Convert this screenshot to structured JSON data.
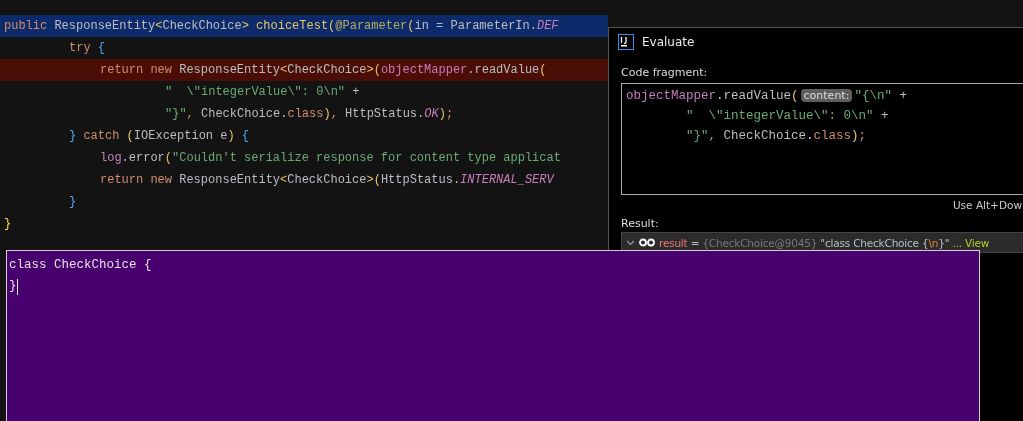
{
  "editor": {
    "lines": [
      {
        "selected": true,
        "breakpoint": false,
        "tokens": [
          {
            "kind": "keyword",
            "text": "public"
          },
          {
            "kind": "plain",
            "text": " ResponseEntity"
          },
          {
            "kind": "angle",
            "text": "<"
          },
          {
            "kind": "plain",
            "text": "CheckChoice"
          },
          {
            "kind": "angle",
            "text": ">"
          },
          {
            "kind": "method",
            "text": " choiceTest"
          },
          {
            "kind": "paren",
            "text": "("
          },
          {
            "kind": "annotation",
            "text": "@Parameter"
          },
          {
            "kind": "paren",
            "text": "("
          },
          {
            "kind": "plain",
            "text": "in = ParameterIn."
          },
          {
            "kind": "static",
            "text": "DEF"
          }
        ],
        "children": [
          {
            "tokens": [
              {
                "kind": "keyword",
                "text": "try"
              },
              {
                "kind": "brace",
                "text": " {"
              }
            ],
            "children": [
              {
                "selected": false,
                "breakpoint": true,
                "tokens": [
                  {
                    "kind": "keyword",
                    "text": "return new"
                  },
                  {
                    "kind": "plain",
                    "text": " ResponseEntity"
                  },
                  {
                    "kind": "angle",
                    "text": "<"
                  },
                  {
                    "kind": "plain",
                    "text": "CheckChoice"
                  },
                  {
                    "kind": "angle",
                    "text": ">"
                  },
                  {
                    "kind": "paren",
                    "text": "("
                  },
                  {
                    "kind": "field",
                    "text": "objectMapper"
                  },
                  {
                    "kind": "plain",
                    "text": ".readValue"
                  },
                  {
                    "kind": "paren",
                    "text": "("
                  }
                ],
                "children": [
                  {
                    "tokens": [
                      {
                        "kind": "string",
                        "text": "\"  \\\"integerValue\\\": 0\\n\""
                      },
                      {
                        "kind": "plain",
                        "text": " +"
                      }
                    ]
                  },
                  {
                    "tokens": [
                      {
                        "kind": "string",
                        "text": "\"}\""
                      },
                      {
                        "kind": "keyword",
                        "text": ","
                      },
                      {
                        "kind": "plain",
                        "text": " CheckChoice."
                      },
                      {
                        "kind": "keyword",
                        "text": "class"
                      },
                      {
                        "kind": "paren",
                        "text": ")"
                      },
                      {
                        "kind": "keyword",
                        "text": ","
                      },
                      {
                        "kind": "plain",
                        "text": " HttpStatus."
                      },
                      {
                        "kind": "static",
                        "text": "OK"
                      },
                      {
                        "kind": "paren",
                        "text": ")"
                      },
                      {
                        "kind": "keyword",
                        "text": ";"
                      }
                    ]
                  }
                ]
              }
            ]
          },
          {
            "tokens": [
              {
                "kind": "brace",
                "text": "}"
              },
              {
                "kind": "keyword",
                "text": " catch"
              },
              {
                "kind": "paren",
                "text": " ("
              },
              {
                "kind": "plain",
                "text": "IOException e"
              },
              {
                "kind": "paren",
                "text": ")"
              },
              {
                "kind": "brace",
                "text": " {"
              }
            ],
            "children": [
              {
                "tokens": [
                  {
                    "kind": "field",
                    "text": "log"
                  },
                  {
                    "kind": "plain",
                    "text": ".error"
                  },
                  {
                    "kind": "paren",
                    "text": "("
                  },
                  {
                    "kind": "string",
                    "text": "\"Couldn't serialize response for content type applicat"
                  }
                ]
              },
              {
                "tokens": [
                  {
                    "kind": "keyword",
                    "text": "return new"
                  },
                  {
                    "kind": "plain",
                    "text": " ResponseEntity"
                  },
                  {
                    "kind": "angle",
                    "text": "<"
                  },
                  {
                    "kind": "plain",
                    "text": "CheckChoice"
                  },
                  {
                    "kind": "angle",
                    "text": ">"
                  },
                  {
                    "kind": "paren",
                    "text": "("
                  },
                  {
                    "kind": "plain",
                    "text": "HttpStatus."
                  },
                  {
                    "kind": "static",
                    "text": "INTERNAL_SERV"
                  }
                ]
              }
            ]
          },
          {
            "tokens": [
              {
                "kind": "brace",
                "text": "}"
              }
            ]
          }
        ]
      },
      {
        "tokens": [
          {
            "kind": "outer",
            "text": "}"
          }
        ]
      }
    ]
  },
  "evaluate_dialog": {
    "title": "Evaluate",
    "code_label": "Code fragment:",
    "code_lines": [
      {
        "tokens": [
          {
            "kind": "field",
            "text": "objectMapper"
          },
          {
            "kind": "plain",
            "text": ".readValue"
          },
          {
            "kind": "paren",
            "text": "("
          },
          {
            "kind": "hint",
            "text": "content:"
          },
          {
            "kind": "string",
            "text": "\"{\\n\""
          },
          {
            "kind": "plain",
            "text": " +"
          }
        ]
      },
      {
        "tokens": [
          {
            "kind": "string",
            "text": "        \"  \\\"integerValue\\\": 0\\n\""
          },
          {
            "kind": "plain",
            "text": " +"
          }
        ]
      },
      {
        "tokens": [
          {
            "kind": "string",
            "text": "        \"}\""
          },
          {
            "kind": "keyword",
            "text": ","
          },
          {
            "kind": "plain",
            "text": " CheckChoice."
          },
          {
            "kind": "keyword",
            "text": "class"
          },
          {
            "kind": "paren",
            "text": ")"
          },
          {
            "kind": "keyword",
            "text": ";"
          }
        ]
      }
    ],
    "hint": "Use Alt+Dow",
    "result_label": "Result:",
    "result": {
      "expanded": true,
      "tokens": [
        {
          "kind": "name",
          "text": "result"
        },
        {
          "kind": "plain",
          "text": " = "
        },
        {
          "kind": "id",
          "text": "{CheckChoice@9045}"
        },
        {
          "kind": "plain",
          "text": " \"class CheckChoice {"
        },
        {
          "kind": "escape",
          "text": "\\n"
        },
        {
          "kind": "plain",
          "text": "}\""
        },
        {
          "kind": "link",
          "text": " ... View"
        }
      ]
    }
  },
  "console": {
    "lines": [
      "class CheckChoice {",
      "}"
    ]
  }
}
